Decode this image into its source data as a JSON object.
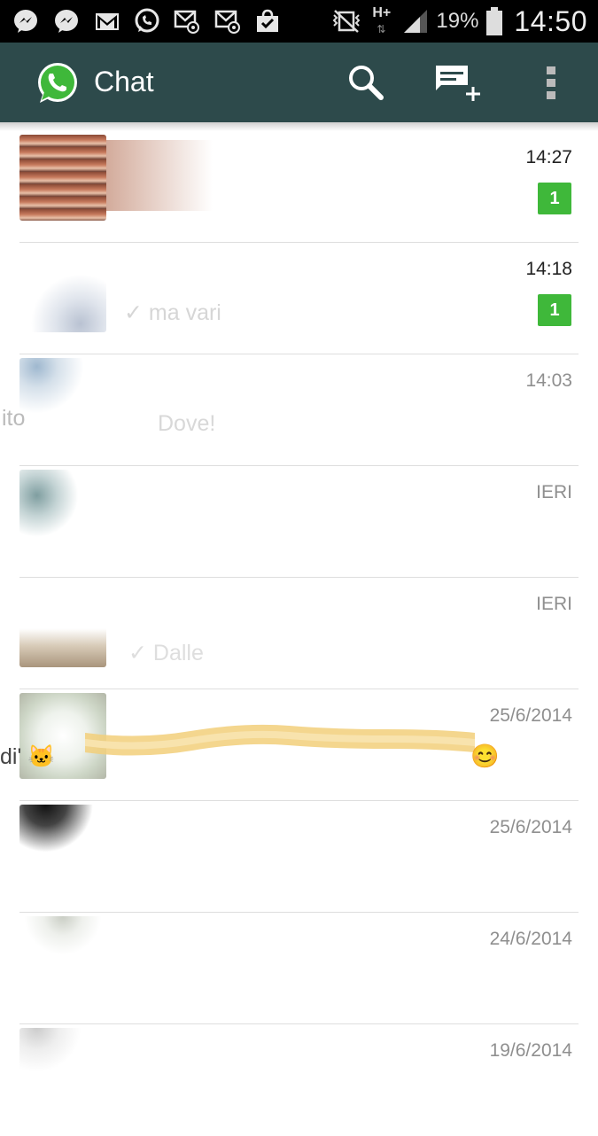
{
  "status_bar": {
    "battery_percent": "19%",
    "time": "14:50",
    "network": "H+",
    "icons": [
      "messenger-icon",
      "messenger-icon",
      "gmail-icon",
      "whatsapp-icon",
      "email-icon",
      "email-icon",
      "shopping-bag-icon",
      "vibrate-icon",
      "network-hplus-icon",
      "signal-icon",
      "battery-icon"
    ]
  },
  "header": {
    "title": "Chat",
    "icons": [
      "whatsapp-logo",
      "search-icon",
      "new-chat-icon",
      "overflow-menu-icon"
    ]
  },
  "colors": {
    "header_bg": "#2d4a4b",
    "badge_green": "#3fb83a",
    "status_bar_bg": "#000000"
  },
  "chats": [
    {
      "time": "14:27",
      "unread": "1"
    },
    {
      "time": "14:18",
      "unread": "1",
      "preview": "✓ ma vari"
    },
    {
      "time": "14:03",
      "preview": "Dove!",
      "left_fragment": "ito"
    },
    {
      "time": "IERI"
    },
    {
      "time": "IERI",
      "preview": "✓ Dalle"
    },
    {
      "time": "25/6/2014",
      "preview": "di' 🐱",
      "emoji": "😊"
    },
    {
      "time": "25/6/2014"
    },
    {
      "time": "24/6/2014"
    },
    {
      "time": "19/6/2014"
    }
  ]
}
